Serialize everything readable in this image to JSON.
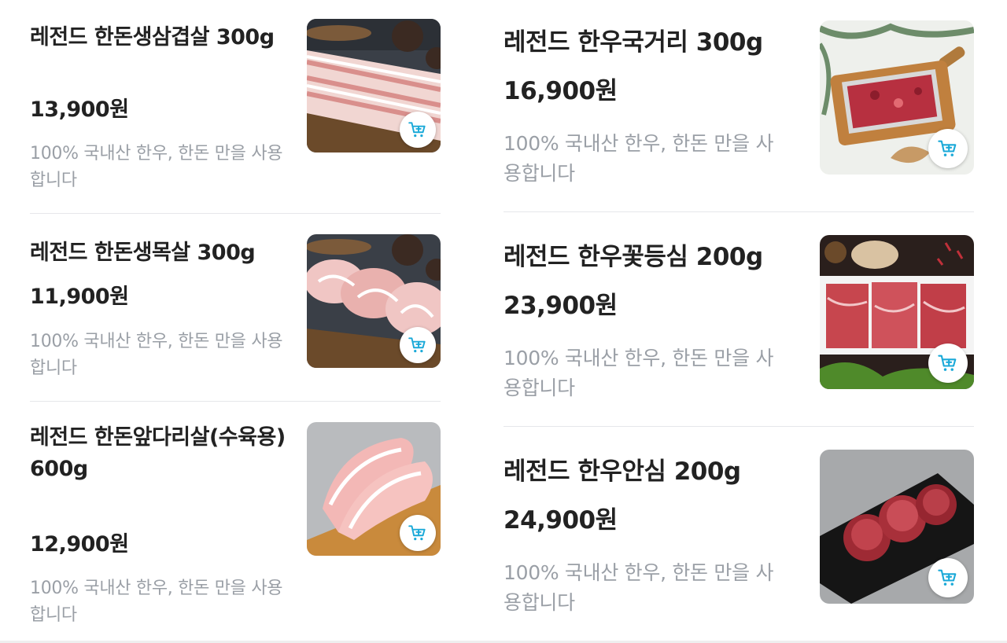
{
  "cart_icon": "cart-plus-icon",
  "colors": {
    "accent": "#1aa9d8",
    "desc": "#9a9fa6",
    "title": "#222222",
    "divider": "#e6e7ea"
  },
  "left_products": [
    {
      "name": "레전드 한돈생삼겹살 300g",
      "price": "13,900원",
      "desc": "100% 국내산 한우, 한돈 만을 사용합니다"
    },
    {
      "name": "레전드 한돈생목살 300g",
      "price": "11,900원",
      "desc": "100% 국내산 한우, 한돈 만을 사용합니다"
    },
    {
      "name": "레전드 한돈앞다리살(수육용) 600g",
      "price": "12,900원",
      "desc": "100% 국내산 한우, 한돈 만을 사용합니다"
    }
  ],
  "right_products": [
    {
      "name": "레전드 한우국거리 300g",
      "price": "16,900원",
      "desc": "100% 국내산 한우, 한돈 만을 사용합니다"
    },
    {
      "name": "레전드 한우꽃등심 200g",
      "price": "23,900원",
      "desc": "100% 국내산 한우, 한돈 만을 사용합니다"
    },
    {
      "name": "레전드 한우안심 200g",
      "price": "24,900원",
      "desc": "100% 국내산 한우, 한돈 만을 사용합니다"
    }
  ]
}
